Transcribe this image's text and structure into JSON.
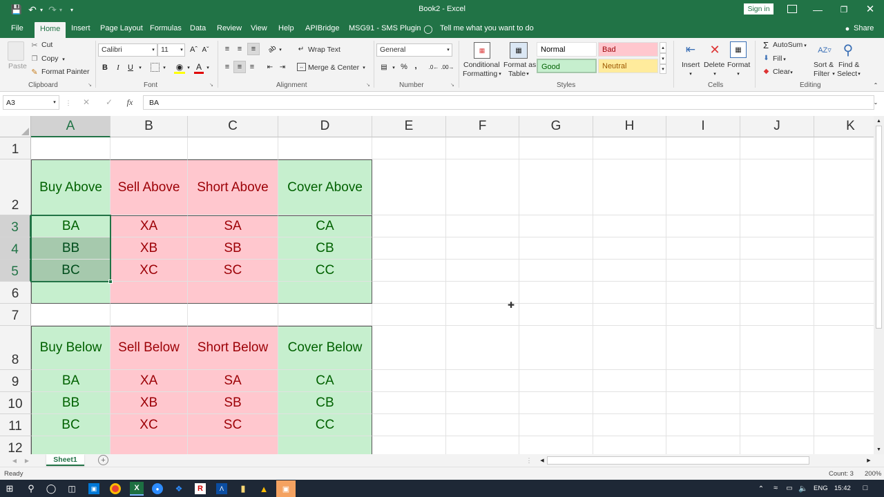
{
  "titlebar": {
    "title": "Book2  -  Excel",
    "signin": "Sign in"
  },
  "tabs": [
    "File",
    "Home",
    "Insert",
    "Page Layout",
    "Formulas",
    "Data",
    "Review",
    "View",
    "Help",
    "APIBridge",
    "MSG91 - SMS Plugin"
  ],
  "tellme": "Tell me what you want to do",
  "share": "Share",
  "ribbon": {
    "clipboard": {
      "paste": "Paste",
      "cut": "Cut",
      "copy": "Copy",
      "format_painter": "Format Painter",
      "label": "Clipboard"
    },
    "font": {
      "name": "Calibri",
      "size": "11",
      "label": "Font"
    },
    "alignment": {
      "wrap": "Wrap Text",
      "merge": "Merge & Center",
      "label": "Alignment"
    },
    "number": {
      "format": "General",
      "label": "Number"
    },
    "styles": {
      "cond_fmt": "Conditional",
      "cond_fmt2": "Formatting",
      "fmt_table": "Format as",
      "fmt_table2": "Table",
      "normal": "Normal",
      "bad": "Bad",
      "good": "Good",
      "neutral": "Neutral",
      "label": "Styles"
    },
    "cells": {
      "insert": "Insert",
      "delete": "Delete",
      "format": "Format",
      "label": "Cells"
    },
    "editing": {
      "autosum": "AutoSum",
      "fill": "Fill",
      "clear": "Clear",
      "sort": "Sort &",
      "sort2": "Filter",
      "find": "Find &",
      "find2": "Select",
      "label": "Editing"
    }
  },
  "formula_bar": {
    "namebox": "A3",
    "fx": "fx",
    "content": "BA"
  },
  "columns": [
    "A",
    "B",
    "C",
    "D",
    "E",
    "F",
    "G",
    "H",
    "I",
    "J",
    "K"
  ],
  "rows": [
    "1",
    "2",
    "3",
    "4",
    "5",
    "6",
    "7",
    "8",
    "9",
    "10",
    "11",
    "12"
  ],
  "table1": {
    "headers": [
      "Buy Above",
      "Sell Above",
      "Short Above",
      "Cover Above"
    ],
    "rows": [
      [
        "BA",
        "XA",
        "SA",
        "CA"
      ],
      [
        "BB",
        "XB",
        "SB",
        "CB"
      ],
      [
        "BC",
        "XC",
        "SC",
        "CC"
      ]
    ]
  },
  "table2": {
    "headers": [
      "Buy Below",
      "Sell Below",
      "Short Below",
      "Cover Below"
    ],
    "rows": [
      [
        "BA",
        "XA",
        "SA",
        "CA"
      ],
      [
        "BB",
        "XB",
        "SB",
        "CB"
      ],
      [
        "BC",
        "XC",
        "SC",
        "CC"
      ]
    ]
  },
  "sheet": {
    "tab": "Sheet1"
  },
  "status": {
    "ready": "Ready",
    "count": "Count: 3",
    "zoom": "200%"
  },
  "taskbar": {
    "lang": "ENG",
    "time": "15:42"
  },
  "colors": {
    "excel_green": "#217346",
    "good_fill": "#c6efce",
    "good_text": "#006100",
    "bad_fill": "#ffc7ce",
    "bad_text": "#9c0006",
    "neutral_fill": "#ffeb9c"
  }
}
